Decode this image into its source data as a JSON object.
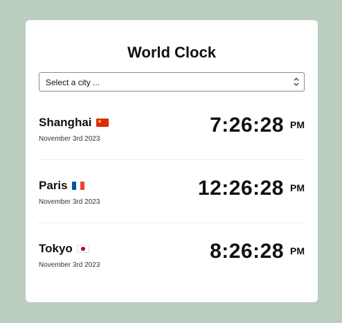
{
  "app": {
    "title": "World Clock"
  },
  "city_select": {
    "selected_text": "Select a city ...",
    "chevron_icon": "chevron-updown-icon"
  },
  "cities": [
    {
      "name": "Shanghai",
      "flag": "china-flag-icon",
      "date": "November 3rd 2023",
      "time": "7:26:28",
      "ampm": "PM"
    },
    {
      "name": "Paris",
      "flag": "france-flag-icon",
      "date": "November 3rd 2023",
      "time": "12:26:28",
      "ampm": "PM"
    },
    {
      "name": "Tokyo",
      "flag": "japan-flag-icon",
      "date": "November 3rd 2023",
      "time": "8:26:28",
      "ampm": "PM"
    }
  ],
  "colors": {
    "background": "#bbcdbf",
    "card": "#ffffff",
    "text": "#111111"
  }
}
